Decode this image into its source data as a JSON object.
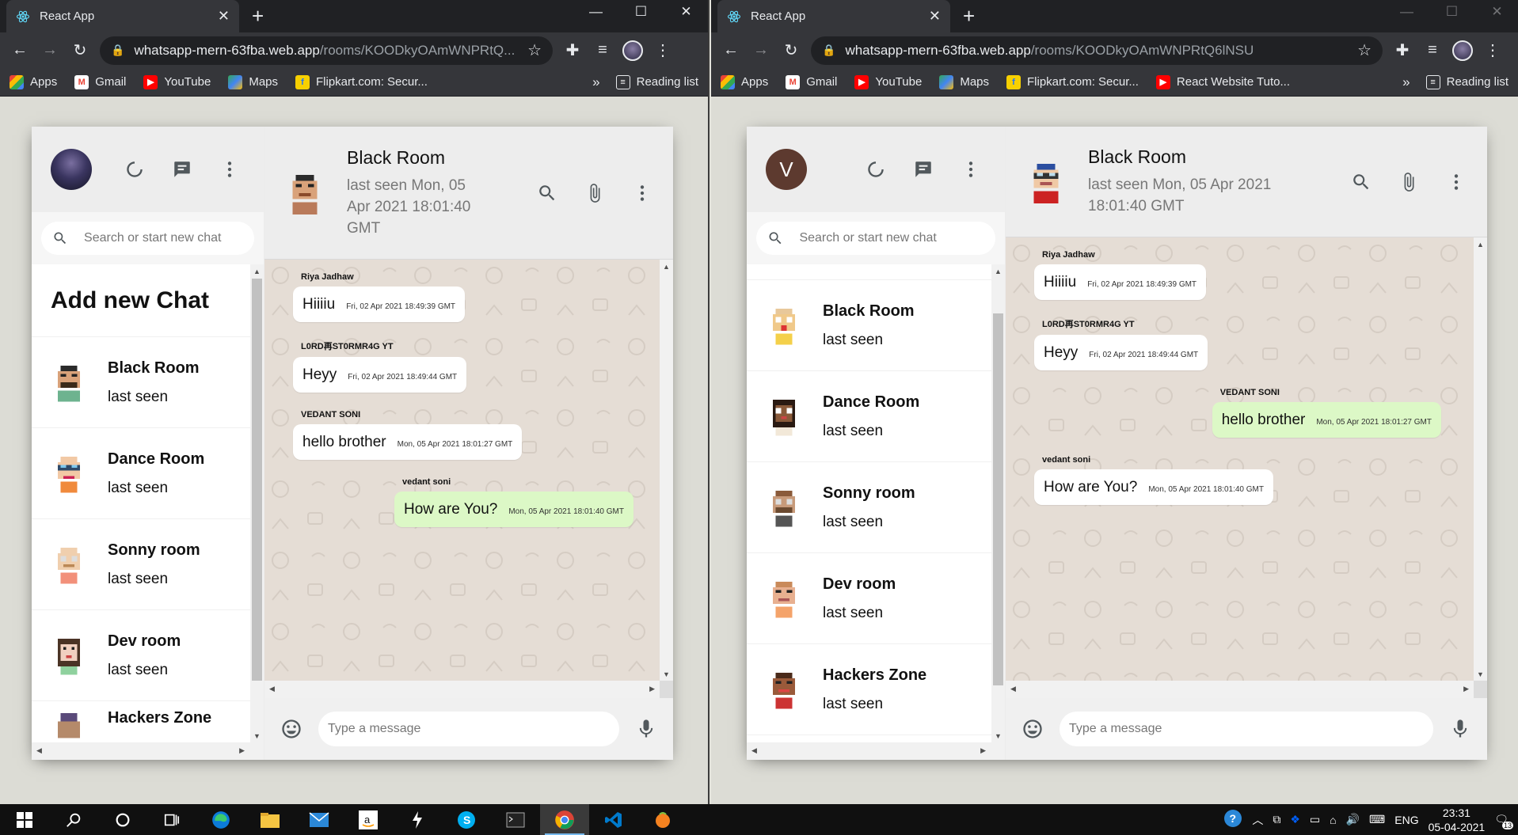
{
  "browser": {
    "tab_title": "React App",
    "url_host": "whatsapp-mern-63fba.web.app",
    "left_url_path": "/rooms/KOODkyOAmWNPRtQ...",
    "right_url_path": "/rooms/KOODkyOAmWNPRtQ6lNSU",
    "bookmarks_left": [
      "Apps",
      "Gmail",
      "YouTube",
      "Maps",
      "Flipkart.com: Secur..."
    ],
    "bookmarks_right": [
      "Apps",
      "Gmail",
      "YouTube",
      "Maps",
      "Flipkart.com: Secur...",
      "React Website Tuto..."
    ],
    "reading_list": "Reading list"
  },
  "left": {
    "avatar_initial": "",
    "search_placeholder": "Search or start new chat",
    "add_new_chat": "Add new Chat",
    "rooms": [
      {
        "name": "Black Room",
        "status": "last seen"
      },
      {
        "name": "Dance Room",
        "status": "last seen"
      },
      {
        "name": "Sonny room",
        "status": "last seen"
      },
      {
        "name": "Dev room",
        "status": "last seen"
      },
      {
        "name": "Hackers Zone",
        "status": ""
      }
    ],
    "chat": {
      "room_name": "Black Room",
      "last_seen": "last seen Mon, 05 Apr 2021 18:01:40 GMT",
      "messages": [
        {
          "sender": "Riya Jadhaw",
          "text": "Hiiiiu",
          "time": "Fri, 02 Apr 2021 18:49:39 GMT",
          "mine": false
        },
        {
          "sender": "L0RD再ST0RMR4G YT",
          "text": "Heyy",
          "time": "Fri, 02 Apr 2021 18:49:44 GMT",
          "mine": false
        },
        {
          "sender": "VEDANT SONI",
          "text": "hello brother",
          "time": "Mon, 05 Apr 2021 18:01:27 GMT",
          "mine": false
        },
        {
          "sender": "vedant soni",
          "text": "How are You?",
          "time": "Mon, 05 Apr 2021 18:01:40 GMT",
          "mine": true
        }
      ],
      "input_placeholder": "Type a message"
    }
  },
  "right": {
    "avatar_initial": "V",
    "search_placeholder": "Search or start new chat",
    "rooms": [
      {
        "name": "Black Room",
        "status": "last seen"
      },
      {
        "name": "Dance Room",
        "status": "last seen"
      },
      {
        "name": "Sonny room",
        "status": "last seen"
      },
      {
        "name": "Dev room",
        "status": "last seen"
      },
      {
        "name": "Hackers Zone",
        "status": "last seen"
      }
    ],
    "chat": {
      "room_name": "Black Room",
      "last_seen": "last seen Mon, 05 Apr 2021 18:01:40 GMT",
      "messages": [
        {
          "sender": "Riya Jadhaw",
          "text": "Hiiiiu",
          "time": "Fri, 02 Apr 2021 18:49:39 GMT",
          "mine": false
        },
        {
          "sender": "L0RD再ST0RMR4G YT",
          "text": "Heyy",
          "time": "Fri, 02 Apr 2021 18:49:44 GMT",
          "mine": false
        },
        {
          "sender": "VEDANT SONI",
          "text": "hello brother",
          "time": "Mon, 05 Apr 2021 18:01:27 GMT",
          "mine": true
        },
        {
          "sender": "vedant soni",
          "text": "How are You?",
          "time": "Mon, 05 Apr 2021 18:01:40 GMT",
          "mine": false
        }
      ],
      "input_placeholder": "Type a message"
    }
  },
  "taskbar": {
    "language": "ENG",
    "time": "23:31",
    "date": "05-04-2021",
    "notification_count": "13"
  },
  "colors": {
    "header_bg": "#ededed",
    "own_bubble": "#dcf8c6",
    "chat_bg": "#e5ddd5",
    "chrome_dark": "#35363a"
  }
}
